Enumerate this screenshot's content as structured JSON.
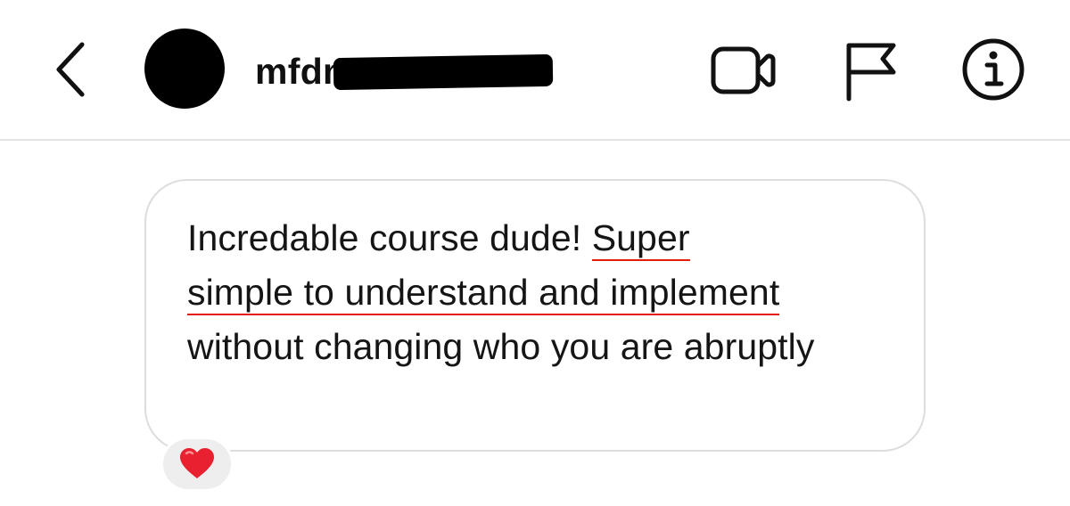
{
  "header": {
    "username": "mfdm",
    "icons": {
      "back": "chevron-left-icon",
      "video": "video-camera-icon",
      "report": "flag-icon",
      "info": "info-icon"
    }
  },
  "message": {
    "text_before": "Incredable course dude! ",
    "text_highlight_1": "Super",
    "text_highlight_2": "simple to understand and implement",
    "text_after": "without changing who you are abruptly",
    "highlight_color": "#e31c0f"
  },
  "reaction": {
    "icon": "heart-icon",
    "color": "#e8202f"
  }
}
